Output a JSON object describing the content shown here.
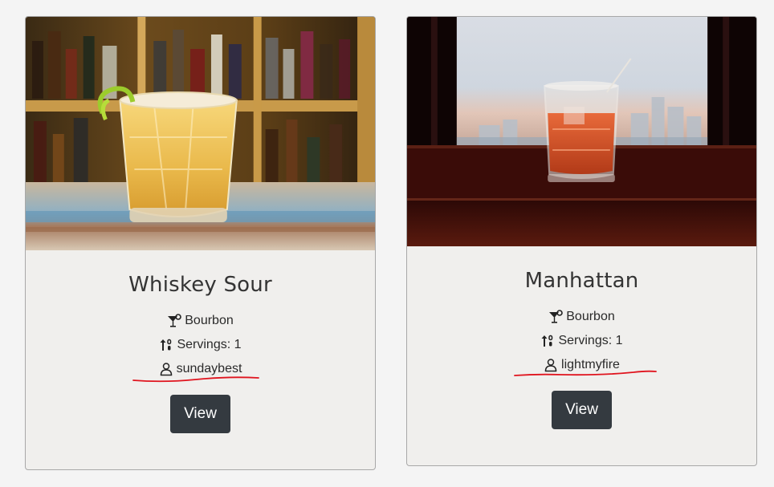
{
  "cards": [
    {
      "title": "Whiskey Sour",
      "spirit": "Bourbon",
      "servings": "Servings: 1",
      "author": "sundaybest",
      "view_label": "View",
      "image_name": "whiskey-sour-photo"
    },
    {
      "title": "Manhattan",
      "spirit": "Bourbon",
      "servings": "Servings: 1",
      "author": "lightmyfire",
      "view_label": "View",
      "image_name": "manhattan-photo"
    }
  ],
  "icons": {
    "spirit": "cocktail-icon",
    "servings": "sort-icon",
    "author": "user-icon"
  },
  "colors": {
    "page_bg": "#f4f4f4",
    "card_bg": "#f0efed",
    "button_bg": "#343a40",
    "annotation": "#e0141e"
  }
}
